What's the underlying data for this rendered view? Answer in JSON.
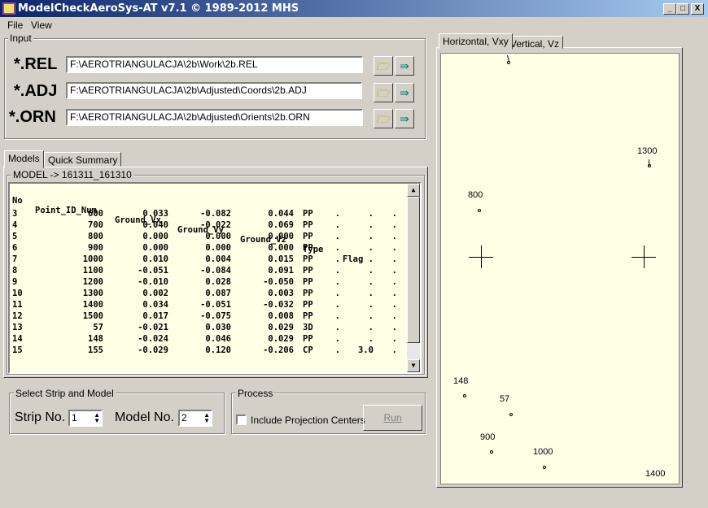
{
  "window": {
    "title": "ModelCheckAeroSys-AT  v7.1 © 1989-2012 MHS",
    "min": "_",
    "max": "□",
    "close": "X"
  },
  "menu": [
    "File",
    "View"
  ],
  "input": {
    "label": "Input",
    "rows": [
      {
        "label": "*.REL",
        "value": "F:\\AEROTRIANGULACJA\\2b\\Work\\2b.REL"
      },
      {
        "label": "*.ADJ",
        "value": "F:\\AEROTRIANGULACJA\\2b\\Adjusted\\Coords\\2b.ADJ"
      },
      {
        "label": "*.ORN",
        "value": "F:\\AEROTRIANGULACJA\\2b\\Adjusted\\Orients\\2b.ORN"
      }
    ]
  },
  "tabs": [
    "Models",
    "Quick Summary"
  ],
  "model_label": "MODEL -> 161311_161310",
  "table": {
    "headers": [
      "No",
      "Point_ID_Num",
      "Ground_Vx",
      "Ground_Vy",
      "Ground_Vz",
      "Type",
      "Flag"
    ],
    "rows": [
      [
        "3",
        "600",
        "0.033",
        "-0.082",
        "0.044",
        "PP",
        ".",
        ".",
        "."
      ],
      [
        "4",
        "700",
        "0.040",
        "-0.022",
        "0.069",
        "PP",
        ".",
        ".",
        "."
      ],
      [
        "5",
        "800",
        "0.000",
        "0.000",
        "0.000",
        "PP",
        ".",
        ".",
        "."
      ],
      [
        "6",
        "900",
        "0.000",
        "0.000",
        "0.000",
        "PP",
        ".",
        ".",
        "."
      ],
      [
        "7",
        "1000",
        "0.010",
        "0.004",
        "0.015",
        "PP",
        ".",
        ".",
        "."
      ],
      [
        "8",
        "1100",
        "-0.051",
        "-0.084",
        "0.091",
        "PP",
        ".",
        ".",
        "."
      ],
      [
        "9",
        "1200",
        "-0.010",
        "0.028",
        "-0.050",
        "PP",
        ".",
        ".",
        "."
      ],
      [
        "10",
        "1300",
        "0.002",
        "0.087",
        "0.003",
        "PP",
        ".",
        ".",
        "."
      ],
      [
        "11",
        "1400",
        "0.034",
        "-0.051",
        "-0.032",
        "PP",
        ".",
        ".",
        "."
      ],
      [
        "12",
        "1500",
        "0.017",
        "-0.075",
        "0.008",
        "PP",
        ".",
        ".",
        "."
      ],
      [
        "13",
        "57",
        "-0.021",
        "0.030",
        "0.029",
        "3D",
        ".",
        ".",
        "."
      ],
      [
        "14",
        "148",
        "-0.024",
        "0.046",
        "0.029",
        "PP",
        ".",
        ".",
        "."
      ],
      [
        "15",
        "155",
        "-0.029",
        "0.120",
        "-0.206",
        "CP",
        ".",
        "3.0",
        "."
      ]
    ]
  },
  "select": {
    "label": "Select  Strip and Model",
    "strip_label": "Strip No.",
    "strip_value": "1",
    "model_label": "Model No.",
    "model_value": "2"
  },
  "process": {
    "label": "Process",
    "checkbox": "Include Projection Centers",
    "checked": false,
    "run": "Run"
  },
  "plot_tabs": [
    "Horizontal, Vxy",
    "Vertical, Vz"
  ],
  "plot_points": [
    "1300",
    "800",
    "148",
    "57",
    "900",
    "1000",
    "1400"
  ]
}
